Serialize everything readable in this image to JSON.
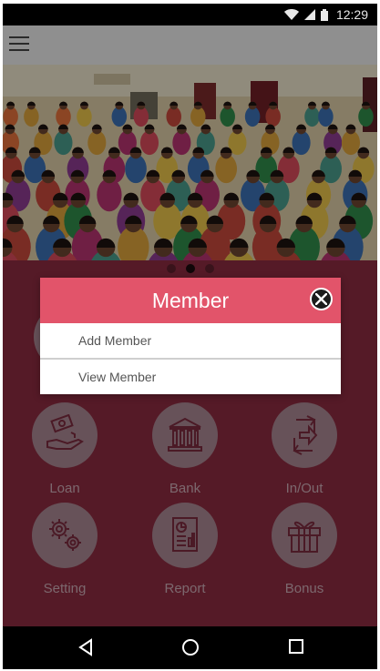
{
  "status_bar": {
    "time": "12:29",
    "icons": [
      "wifi-icon",
      "signal-icon",
      "battery-icon"
    ]
  },
  "app_bar": {
    "menu_icon": "hamburger-menu-icon"
  },
  "banner": {
    "description_icon": "photo-banner",
    "carousel_pages": 3,
    "active_page": 2
  },
  "menu_grid": [
    {
      "label": "Loan",
      "icon": "loan-icon"
    },
    {
      "label": "Bank",
      "icon": "bank-icon"
    },
    {
      "label": "In/Out",
      "icon": "in-out-icon"
    },
    {
      "label": "Setting",
      "icon": "settings-icon"
    },
    {
      "label": "Report",
      "icon": "report-icon"
    },
    {
      "label": "Bonus",
      "icon": "gift-icon"
    }
  ],
  "dialog": {
    "title": "Member",
    "items": [
      {
        "label": "Add Member"
      },
      {
        "label": "View Member"
      }
    ]
  },
  "colors": {
    "background": "#8a2b40",
    "dialog_header": "#e2546a",
    "app_bar": "#8f8f8f"
  }
}
